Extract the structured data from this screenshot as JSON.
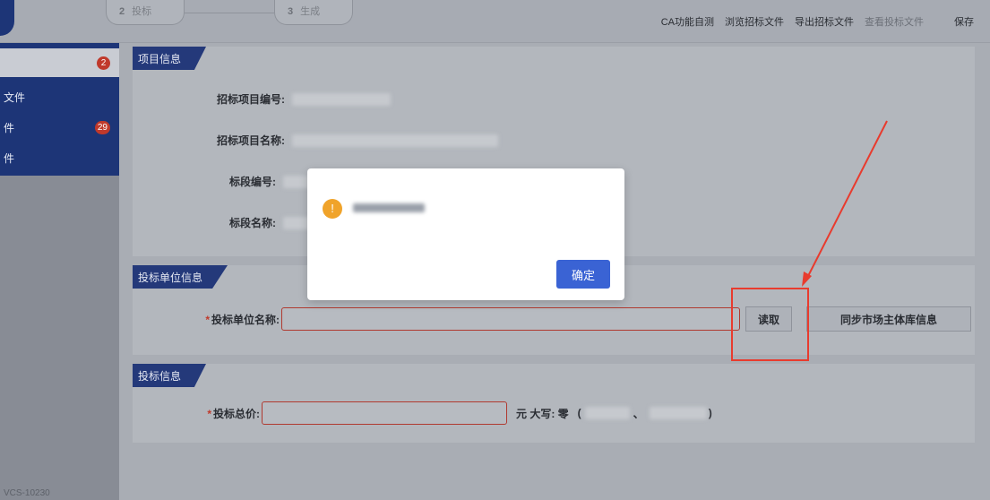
{
  "topbar": {
    "steps": [
      {
        "num": "2",
        "label": "投标"
      },
      {
        "num": "3",
        "label": "生成"
      }
    ],
    "actions": [
      "CA功能自测",
      "浏览招标文件",
      "导出招标文件",
      "查看投标文件"
    ],
    "save_label": "保存"
  },
  "sidebar": {
    "items": [
      {
        "label": "",
        "badge": "2"
      },
      {
        "label": "文件",
        "badge": ""
      },
      {
        "label": "件",
        "badge": "29"
      },
      {
        "label": "件",
        "badge": ""
      }
    ],
    "footer": "VCS-10230"
  },
  "project_panel": {
    "title": "项目信息",
    "fields": [
      {
        "label": "招标项目编号:"
      },
      {
        "label": "招标项目名称:"
      },
      {
        "label": "标段编号:"
      },
      {
        "label": "标段名称:"
      }
    ]
  },
  "bidder_panel": {
    "title": "投标单位信息",
    "required_mark": "*",
    "name_label": "投标单位名称:",
    "read_button": "读取",
    "sync_button": "同步市场主体库信息"
  },
  "bid_panel": {
    "title": "投标信息",
    "required_mark": "*",
    "price_label": "投标总价:",
    "capital_text": "元 大写: 零",
    "open_paren": "(",
    "comma": "、",
    "close_paren": ")"
  },
  "modal": {
    "icon_glyph": "!",
    "ok_label": "确定"
  },
  "colors": {
    "sidebar": "#1d3577",
    "panel_tab": "#24397a",
    "modal_button": "#3a63d4",
    "annotation": "#e83b2e"
  }
}
